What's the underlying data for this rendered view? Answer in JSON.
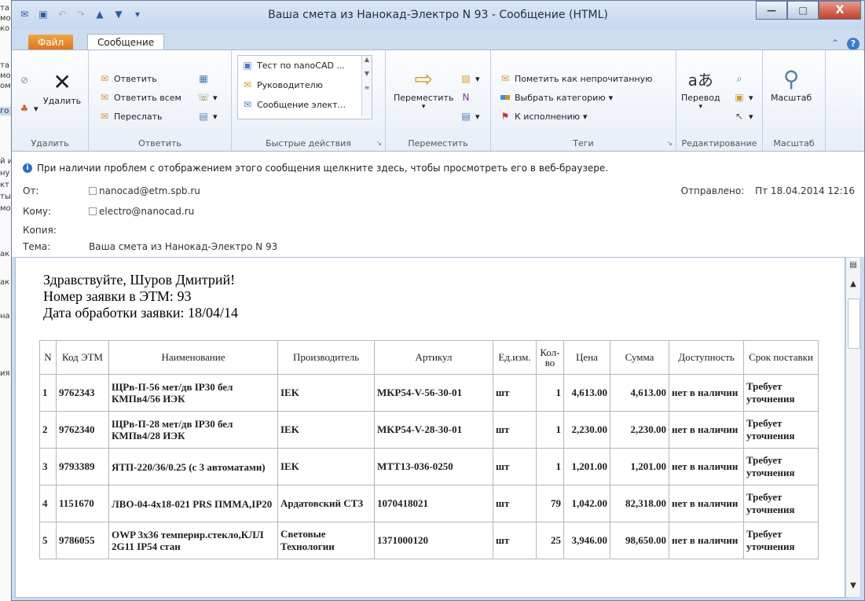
{
  "background_fragments": [
    "та",
    "мо",
    "ко",
    "та",
    "мо",
    "ом",
    "го",
    "й и",
    "ну",
    "кт",
    "ты",
    "мо",
    "ак",
    "ак",
    "на",
    "ия"
  ],
  "window": {
    "title": "Ваша смета из Нанокад-Электро N 93  -  Сообщение (HTML)",
    "controls": {
      "minimize": "—",
      "maximize": "□",
      "close": "X"
    }
  },
  "ribbon_tabs": {
    "file": "Файл",
    "message": "Сообщение"
  },
  "ribbon": {
    "delete_group": {
      "delete_label": "Удалить",
      "group_label": "Удалить"
    },
    "respond_group": {
      "reply": "Ответить",
      "reply_all": "Ответить всем",
      "forward": "Переслать",
      "group_label": "Ответить"
    },
    "quick_steps": {
      "items": [
        "Тест по nanoCAD ...",
        "Руководителю",
        "Сообщение элект..."
      ],
      "group_label": "Быстрые действия"
    },
    "move_group": {
      "move_label": "Переместить",
      "group_label": "Переместить"
    },
    "tags_group": {
      "mark_unread": "Пометить как непрочитанную",
      "categorize": "Выбрать категорию",
      "follow_up": "К исполнению",
      "group_label": "Теги"
    },
    "editing_group": {
      "translate": "Перевод",
      "group_label": "Редактирование"
    },
    "zoom_group": {
      "zoom": "Масштаб",
      "group_label": "Масштаб"
    }
  },
  "header": {
    "info_bar": "При наличии проблем с отображением этого сообщения щелкните здесь, чтобы просмотреть его в веб-браузере.",
    "from_label": "От:",
    "from_value": "nanocad@etm.spb.ru",
    "to_label": "Кому:",
    "to_value": "electro@nanocad.ru",
    "cc_label": "Копия:",
    "subject_label": "Тема:",
    "subject_value": "Ваша смета из Нанокад-Электро N 93",
    "sent_label": "Отправлено:",
    "sent_value": "Пт 18.04.2014 12:16"
  },
  "message": {
    "greeting": "Здравствуйте, Шуров Дмитрий!",
    "order_number": "Номер заявки в ЭТМ: 93",
    "processed_date": "Дата обработки заявки: 18/04/14"
  },
  "table": {
    "headers": [
      "N",
      "Код ЭТМ",
      "Наименование",
      "Производитель",
      "Артикул",
      "Ед.изм.",
      "Кол-во",
      "Цена",
      "Сумма",
      "Доступность",
      "Срок поставки"
    ],
    "rows": [
      [
        "1",
        "9762343",
        "ЩРв-П-56 мет/дв IP30 бел КМПв4/56 ИЭК",
        "IEK",
        "MKP54-V-56-30-01",
        "шт",
        "1",
        "4,613.00",
        "4,613.00",
        "нет в наличии",
        "Требует уточнения"
      ],
      [
        "2",
        "9762340",
        "ЩРв-П-28 мет/дв IP30 бел КМПв4/28 ИЭК",
        "IEK",
        "MKP54-V-28-30-01",
        "шт",
        "1",
        "2,230.00",
        "2,230.00",
        "нет в наличии",
        "Требует уточнения"
      ],
      [
        "3",
        "9793389",
        "ЯТП-220/36/0.25 (с 3 автоматами)",
        "IEK",
        "MTT13-036-0250",
        "шт",
        "1",
        "1,201.00",
        "1,201.00",
        "нет в наличии",
        "Требует уточнения"
      ],
      [
        "4",
        "1151670",
        "ЛВО-04-4х18-021 PRS ПММА,IP20",
        "Ардатовский СТЗ",
        "1070418021",
        "шт",
        "79",
        "1,042.00",
        "82,318.00",
        "нет в наличии",
        "Требует уточнения"
      ],
      [
        "5",
        "9786055",
        "OWP 3х36 темперир.стекло,КЛЛ 2G11 IP54 стан",
        "Световые Технологии",
        "1371000120",
        "шт",
        "25",
        "3,946.00",
        "98,650.00",
        "нет в наличии",
        "Требует уточнения"
      ]
    ]
  }
}
